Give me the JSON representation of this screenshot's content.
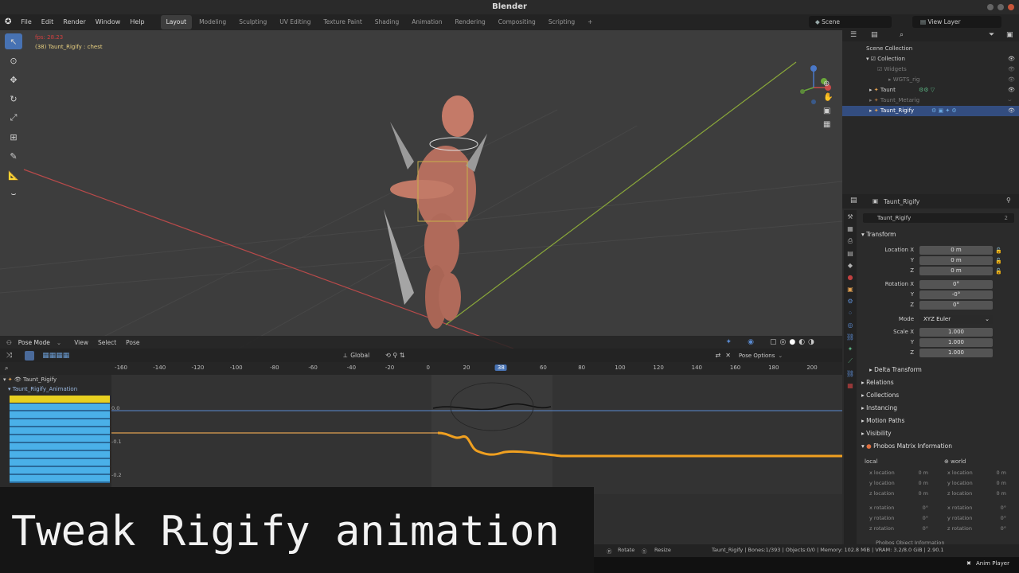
{
  "window": {
    "title": "Blender"
  },
  "menu": {
    "file": "File",
    "edit": "Edit",
    "render": "Render",
    "window": "Window",
    "help": "Help"
  },
  "workspaces": [
    "Layout",
    "Modeling",
    "Sculpting",
    "UV Editing",
    "Texture Paint",
    "Shading",
    "Animation",
    "Rendering",
    "Compositing",
    "Scripting"
  ],
  "scene": {
    "name": "Scene",
    "view_layer": "View Layer"
  },
  "viewport": {
    "fps": "fps: 28.23",
    "object_info": "(38) Taunt_Rigify : chest",
    "mode": "Pose Mode",
    "menus": [
      "View",
      "Select",
      "Pose"
    ],
    "orientation": "Global",
    "pose_options": "Pose Options"
  },
  "outliner": {
    "rows": [
      {
        "label": "Scene Collection",
        "dim": false
      },
      {
        "label": "Collection",
        "dim": false
      },
      {
        "label": "Widgets",
        "dim": true
      },
      {
        "label": "WGTS_rig",
        "dim": true
      },
      {
        "label": "Taunt",
        "dim": false
      },
      {
        "label": "Taunt_Metarig",
        "dim": true
      },
      {
        "label": "Taunt_Rigify",
        "dim": false
      }
    ]
  },
  "properties": {
    "header": "Taunt_Rigify",
    "object_name": "Taunt_Rigify",
    "users": "2",
    "transform_title": "Transform",
    "location_label": "Location X",
    "location": [
      "0 m",
      "0 m",
      "0 m"
    ],
    "rotation_label": "Rotation X",
    "rotation": [
      "0°",
      "-0°",
      "0°"
    ],
    "mode_label": "Mode",
    "mode_value": "XYZ Euler",
    "scale_label": "Scale X",
    "scale": [
      "1.000",
      "1.000",
      "1.000"
    ],
    "y": "Y",
    "z": "Z",
    "sections": [
      "Delta Transform",
      "Relations",
      "Collections",
      "Instancing",
      "Motion Paths",
      "Visibility",
      "Phobos Matrix Information"
    ],
    "local": "local",
    "world": "world",
    "matrix_labels": [
      "x location",
      "y location",
      "z location",
      "x rotation",
      "y rotation",
      "z rotation"
    ],
    "matrix_loc_value": "0 m",
    "matrix_rot_value": "0°",
    "phobos_object": "Phobos Object Information"
  },
  "dopesheet": {
    "ticks": [
      "-160",
      "-140",
      "-120",
      "-100",
      "-80",
      "-60",
      "-40",
      "-20",
      "0",
      "20",
      "38",
      "60",
      "80",
      "100",
      "120",
      "140",
      "160",
      "180",
      "200"
    ],
    "current_frame": "38",
    "rig_name": "Taunt_Rigify",
    "action_name": "Taunt_Rigify_Animation",
    "y_labels": [
      "0.0",
      "-0.1",
      "-0.2"
    ]
  },
  "caption": "Tweak Rigify animation",
  "status": {
    "rotate": "Rotate",
    "resize": "Resize",
    "info": "Taunt_Rigify | Bones:1/393 | Objects:0/0 | Memory: 102.8 MiB | VRAM: 3.2/8.0 GiB | 2.90.1",
    "anim_player": "Anim Player"
  }
}
